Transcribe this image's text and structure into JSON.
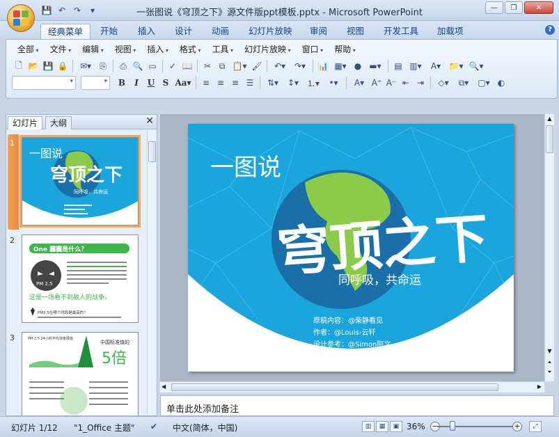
{
  "window": {
    "title": "一张图说《穹顶之下》源文件版ppt模板.pptx - Microsoft PowerPoint",
    "controls": [
      "minimize",
      "restore",
      "close"
    ]
  },
  "ribbon_tabs": [
    "经典菜单",
    "开始",
    "插入",
    "设计",
    "动画",
    "幻灯片放映",
    "审阅",
    "视图",
    "开发工具",
    "加载项"
  ],
  "active_tab": "经典菜单",
  "classic_menus": [
    "全部",
    "文件",
    "编辑",
    "视图",
    "插入",
    "格式",
    "工具",
    "幻灯片放映",
    "窗口",
    "帮助"
  ],
  "panel": {
    "tabs": [
      "幻灯片",
      "大纲"
    ],
    "slides": [
      {
        "num": "1",
        "selected": true
      },
      {
        "num": "2",
        "selected": false
      },
      {
        "num": "3",
        "selected": false
      }
    ]
  },
  "thumb2": {
    "heading": "One 霾霾是什么？",
    "badge": "PM 2.5",
    "tagline": "这是一场看不到敌人的战争。",
    "question": "PM2.5在哪个时段是最高的？"
  },
  "thumb3": {
    "big_value": "5倍",
    "caption": "中国标准值的",
    "header": "PM 2.5 24小时平均浓度限值"
  },
  "slide": {
    "title_small": "一图说",
    "title_big": "穹顶之下",
    "subtitle": "同呼吸，共命运",
    "credits": [
      "原稿内容：@柴静看见",
      "作者：@Louis-云轩",
      "设计参考：@Simon阿文"
    ],
    "bg_color": "#1aa5dc",
    "globe_color": "#1a6fa8",
    "land_color": "#8ccb4a"
  },
  "notes_placeholder": "单击此处添加备注",
  "status": {
    "slide_counter": "幻灯片 1/12",
    "theme": "\"1_Office 主题\"",
    "language": "中文(简体，中国)",
    "zoom": "36%"
  }
}
